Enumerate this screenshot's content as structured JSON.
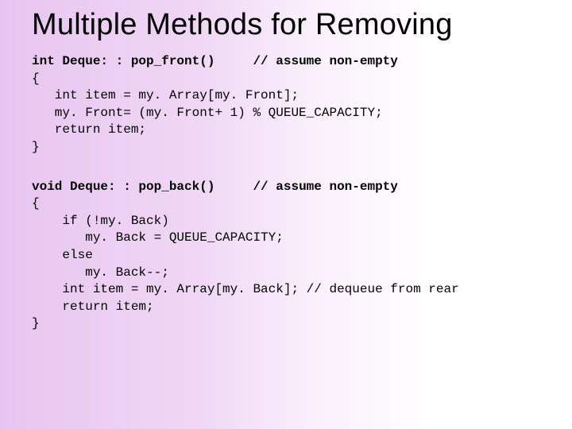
{
  "title": "Multiple Methods for Removing",
  "code1": {
    "sig_left": "int Deque: : pop_front()",
    "sig_right": "// assume non-empty",
    "l1": "{",
    "l2": "   int item = my. Array[my. Front];",
    "l3": "   my. Front= (my. Front+ 1) % QUEUE_CAPACITY;",
    "l4": "   return item;",
    "l5": "}"
  },
  "code2": {
    "sig_left": "void Deque: : pop_back()",
    "sig_right": "// assume non-empty",
    "l1": "{",
    "l2": "    if (!my. Back)",
    "l3": "       my. Back = QUEUE_CAPACITY;",
    "l4": "    else",
    "l5": "       my. Back--;",
    "l6": "    int item = my. Array[my. Back]; // dequeue from rear",
    "l7": "    return item;",
    "l8": "}"
  }
}
